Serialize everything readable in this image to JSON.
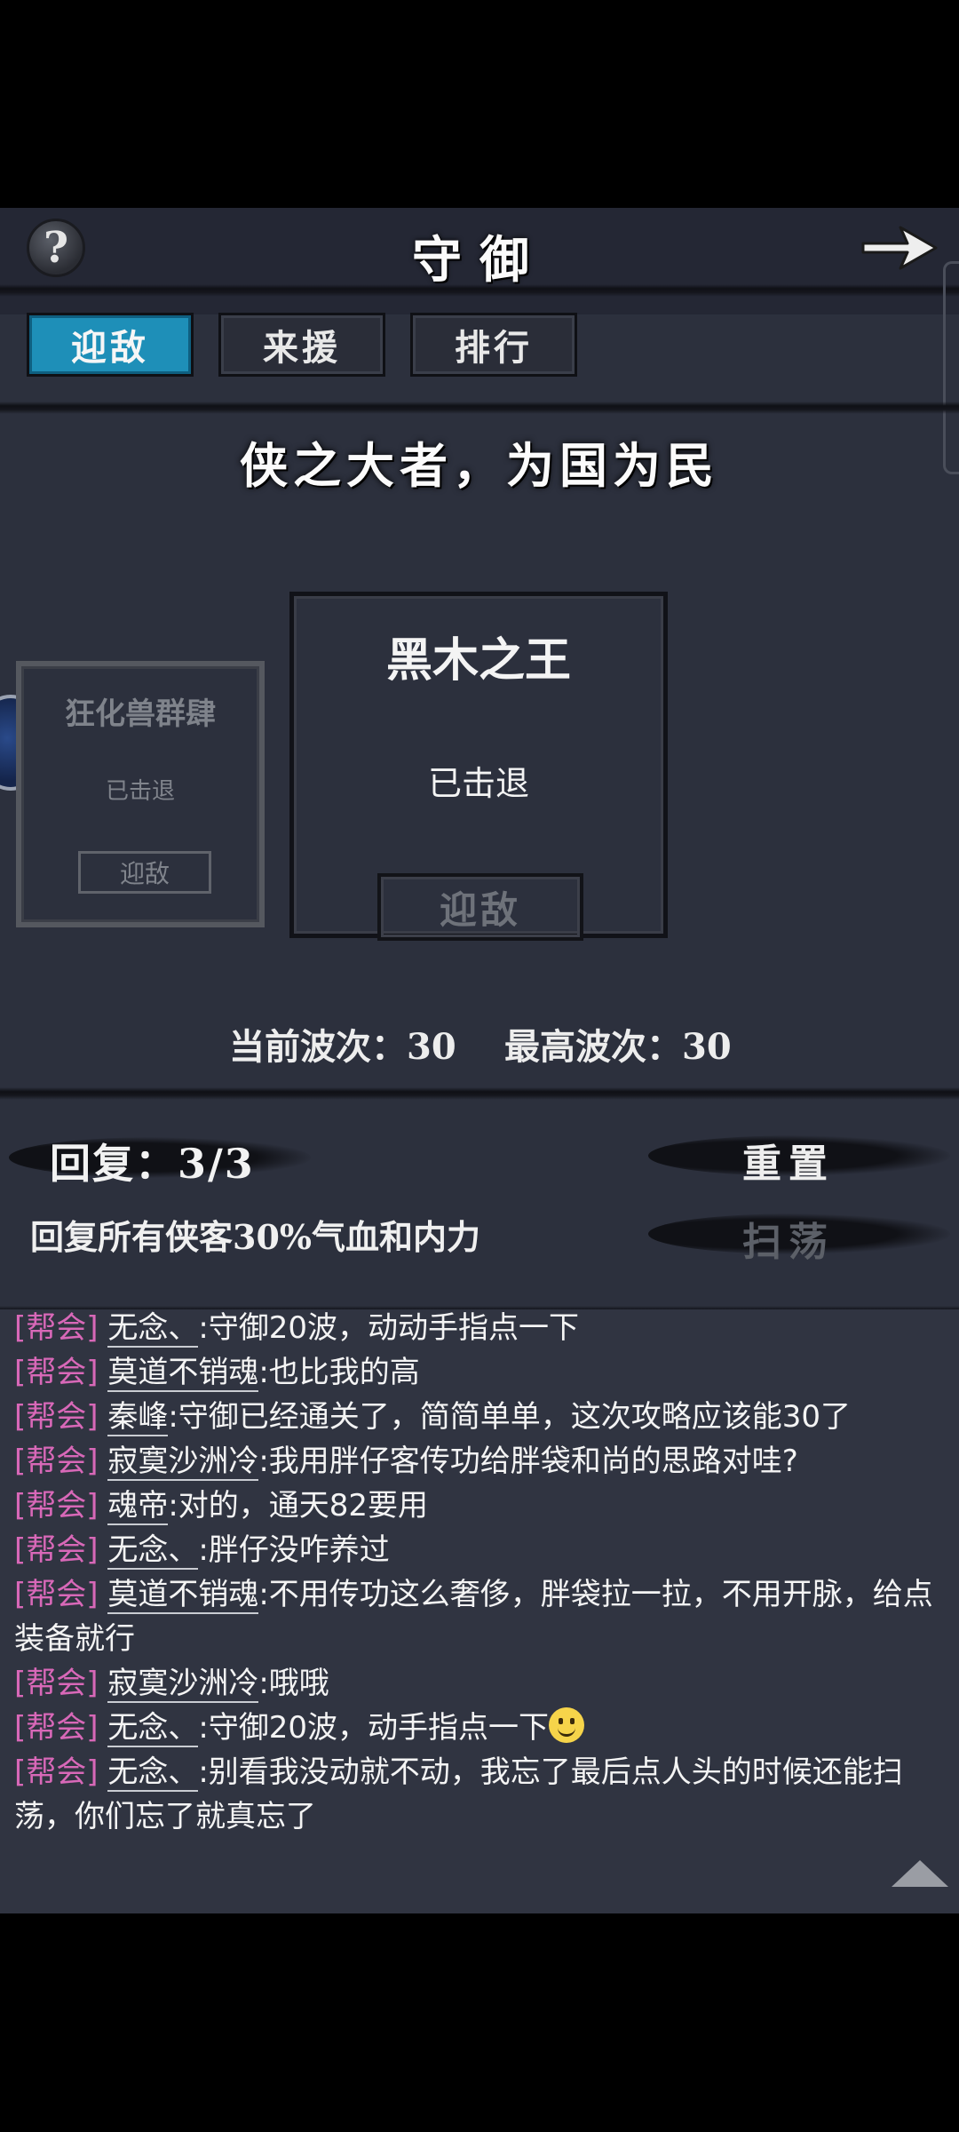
{
  "header": {
    "title": "守御",
    "help_glyph": "?",
    "back_icon": "arrow-right-icon"
  },
  "tabs": [
    {
      "label": "迎敌",
      "active": true
    },
    {
      "label": "来援",
      "active": false
    },
    {
      "label": "排行",
      "active": false
    }
  ],
  "slogan": "侠之大者，为国为民",
  "cards": {
    "prev": {
      "name": "狂化兽群肆",
      "status": "已击退",
      "button": "迎敌"
    },
    "current": {
      "name": "黑木之王",
      "status": "已击退",
      "button": "迎敌"
    }
  },
  "waves": {
    "current_label": "当前波次：",
    "current_value": "30",
    "max_label": "最高波次：",
    "max_value": "30"
  },
  "recovery": {
    "label": "回复：",
    "value": "3/3",
    "description": "回复所有侠客30%气血和内力"
  },
  "buttons": {
    "reset": "重置",
    "sweep": "扫荡"
  },
  "chat": {
    "messages": [
      {
        "tag": "[帮会]",
        "user": "无念、",
        "text": ":守御20波，动动手指点一下"
      },
      {
        "tag": "[帮会]",
        "user": "莫道不销魂",
        "text": ":也比我的高"
      },
      {
        "tag": "[帮会]",
        "user": "秦峰",
        "text": ":守御已经通关了，简简单单，这次攻略应该能30了"
      },
      {
        "tag": "[帮会]",
        "user": "寂寞沙洲冷",
        "text": ":我用胖仔客传功给胖袋和尚的思路对哇?"
      },
      {
        "tag": "[帮会]",
        "user": "魂帝",
        "text": ":对的，通天82要用"
      },
      {
        "tag": "[帮会]",
        "user": "无念、",
        "text": ":胖仔没咋养过"
      },
      {
        "tag": "[帮会]",
        "user": "莫道不销魂",
        "text": ":不用传功这么奢侈，胖袋拉一拉，不用开脉，给点装备就行"
      },
      {
        "tag": "[帮会]",
        "user": "寂寞沙洲冷",
        "text": ":哦哦"
      },
      {
        "tag": "[帮会]",
        "user": "无念、",
        "text": ":守御20波，动手指点一下"
      },
      {
        "tag": "[帮会]",
        "user": "无念、",
        "text": ":别看我没动就不动，我忘了最后点人头的时候还能扫荡，你们忘了就真忘了"
      }
    ],
    "emoji": "smiley-icon"
  },
  "colors": {
    "active_tab": "#1e8fb8",
    "chat_tag": "#d868b8",
    "background": "#2c303d"
  }
}
